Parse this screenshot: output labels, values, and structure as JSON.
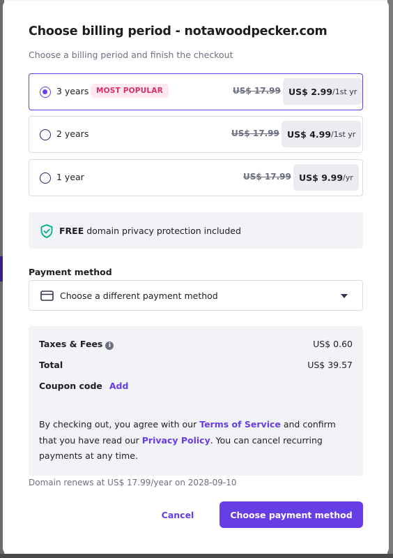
{
  "dialog": {
    "title": "Choose billing period - notawoodpecker.com",
    "subtitle": "Choose a billing period and finish the checkout"
  },
  "periods": [
    {
      "label": "3 years",
      "badge": "MOST POPULAR",
      "old_price": "US$ 17.99",
      "price": "US$ 2.99",
      "unit": "/1st yr",
      "selected": true
    },
    {
      "label": "2 years",
      "old_price": "US$ 17.99",
      "price": "US$ 4.99",
      "unit": "/1st yr",
      "selected": false
    },
    {
      "label": "1 year",
      "old_price": "US$ 17.99",
      "price": "US$ 9.99",
      "unit": "/yr",
      "selected": false
    }
  ],
  "privacy": {
    "strong": "FREE",
    "text": " domain privacy protection included"
  },
  "payment": {
    "label": "Payment method",
    "select_value": "Choose a different payment method"
  },
  "summary": {
    "taxes_label": "Taxes & Fees",
    "taxes_value": "US$ 0.60",
    "total_label": "Total",
    "total_value": "US$ 39.57",
    "coupon_label": "Coupon code",
    "coupon_link": "Add",
    "terms_1": "By checking out, you agree with our ",
    "terms_link_1": "Terms of Service",
    "terms_2": " and confirm that you have read our ",
    "terms_link_2": "Privacy Policy",
    "terms_3": ". You can cancel recurring payments at any time."
  },
  "renew_note": "Domain renews at US$ 17.99/year on 2028-09-10",
  "actions": {
    "cancel": "Cancel",
    "primary": "Choose payment method"
  },
  "colors": {
    "accent": "#673de6",
    "badge_text": "#d63163",
    "badge_bg": "#ffe8ef",
    "shield": "#00b090"
  }
}
